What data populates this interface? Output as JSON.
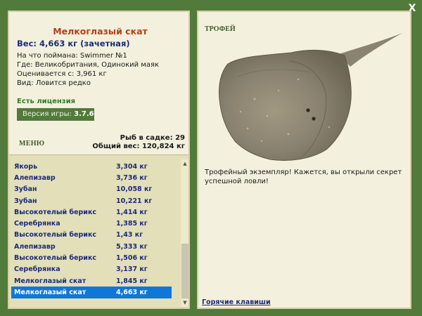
{
  "window": {
    "close_label": "X"
  },
  "fish": {
    "name": "Мелкоглазый скат",
    "weight": "Вес: 4,663 кг (зачетная)",
    "bait": "На что поймана: Swimmer №1",
    "location": "Где: Великобритания, Одинокий маяк",
    "value": "Оценивается с: 3,961 кг",
    "species": "Вид: Ловится редко"
  },
  "license": "Есть лицензия",
  "version": {
    "label": "Версия игры:",
    "value": "3.7.6"
  },
  "menu_label": "МЕНЮ",
  "stats": {
    "fish_count": "Рыб в садке: 29",
    "total_weight": "Общий вес: 120,824 кг"
  },
  "catch_list": [
    {
      "name": "Якорь",
      "weight": "3,304 кг"
    },
    {
      "name": "Алепизавр",
      "weight": "3,736 кг"
    },
    {
      "name": "Зубан",
      "weight": "10,058 кг"
    },
    {
      "name": "Зубан",
      "weight": "10,221 кг"
    },
    {
      "name": "Высокотелый берикс",
      "weight": "1,414 кг"
    },
    {
      "name": "Серебрянка",
      "weight": "1,385 кг"
    },
    {
      "name": "Высокотелый берикс",
      "weight": "1,43 кг"
    },
    {
      "name": "Алепизавр",
      "weight": "5,333 кг"
    },
    {
      "name": "Высокотелый берикс",
      "weight": "1,506 кг"
    },
    {
      "name": "Серебрянка",
      "weight": "3,137 кг"
    },
    {
      "name": "Мелкоглазый скат",
      "weight": "1,845 кг"
    },
    {
      "name": "Мелкоглазый скат",
      "weight": "4,663 кг",
      "selected": true
    }
  ],
  "trophy": {
    "label": "ТРОФЕЙ",
    "message": "Трофейный экземпляр! Кажется, вы открыли секрет успешной ловли!"
  },
  "hotkeys_label": "Горячие клавиши",
  "colors": {
    "background": "#527a3a",
    "panel": "#f3f1dd",
    "list": "#e3dfb9",
    "selection": "#1077d8",
    "fish_name": "#b0411c",
    "link": "#1c2b78"
  }
}
